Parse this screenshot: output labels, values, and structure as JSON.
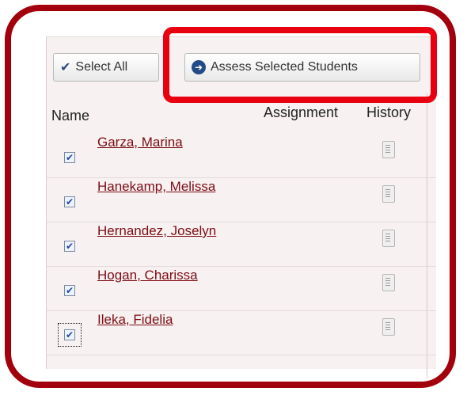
{
  "toolbar": {
    "select_all_label": "Select All",
    "assess_label": "Assess Selected Students",
    "select_all_icon": "checkmark-icon",
    "assess_icon": "arrow-right-circle-icon"
  },
  "table": {
    "headers": {
      "name": "Name",
      "assignment": "Assignment",
      "history": "History"
    },
    "rows": [
      {
        "name": "Garza, Marina",
        "checked": true
      },
      {
        "name": "Hanekamp, Melissa",
        "checked": true
      },
      {
        "name": "Hernandez, Joselyn",
        "checked": true
      },
      {
        "name": "Hogan, Charissa",
        "checked": true
      },
      {
        "name": "Ileka, Fidelia",
        "checked": true
      }
    ]
  },
  "colors": {
    "frame": "#a3000d",
    "highlight": "#e8000f",
    "link": "#7d0d14",
    "panel": "#f7f1f1"
  }
}
